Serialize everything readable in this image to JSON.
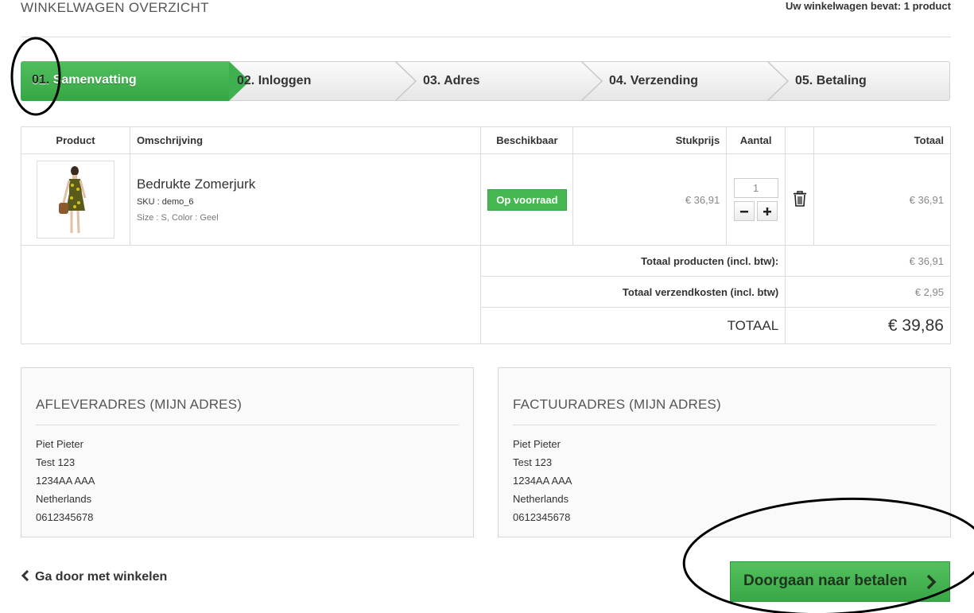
{
  "header": {
    "title": "WINKELWAGEN OVERZICHT",
    "cart_summary": "Uw winkelwagen bevat: 1 product"
  },
  "steps": [
    {
      "num": "01.",
      "label": " Samenvatting",
      "active": true
    },
    {
      "num": "02.",
      "label": " Inloggen",
      "active": false
    },
    {
      "num": "03.",
      "label": " Adres",
      "active": false
    },
    {
      "num": "04.",
      "label": " Verzending",
      "active": false
    },
    {
      "num": "05.",
      "label": " Betaling",
      "active": false
    }
  ],
  "cart_table": {
    "columns": [
      "Product",
      "Omschrijving",
      "Beschikbaar",
      "Stukprijs",
      "Aantal",
      "",
      "Totaal"
    ],
    "items": [
      {
        "name": "Bedrukte Zomerjurk",
        "sku": "SKU : demo_6",
        "attributes": "Size : S, Color : Geel",
        "availability": "Op voorraad",
        "unit_price": "€ 36,91",
        "quantity": "1",
        "total": "€ 36,91"
      }
    ],
    "summary": {
      "products_label": "Totaal producten (incl. btw):",
      "products_value": "€ 36,91",
      "shipping_label": "Totaal verzendkosten (incl. btw)",
      "shipping_value": "€ 2,95",
      "total_label": "TOTAAL",
      "total_value": "€ 39,86"
    }
  },
  "delivery_address": {
    "title": "AFLEVERADRES (MIJN ADRES)",
    "lines": [
      "Piet Pieter",
      "Test 123",
      "1234AA AAA",
      "Netherlands",
      "0612345678"
    ]
  },
  "invoice_address": {
    "title": "FACTUURADRES (MIJN ADRES)",
    "lines": [
      "Piet Pieter",
      "Test 123",
      "1234AA AAA",
      "Netherlands",
      "0612345678"
    ]
  },
  "footer": {
    "continue_shopping": "Ga door met winkelen",
    "proceed_to_pay": "Doorgaan naar betalen"
  },
  "colors": {
    "accent_green": "#46b852",
    "annotation_ink": "#000000"
  },
  "icons": [
    "chevron-left-icon",
    "chevron-right-icon",
    "trash-icon",
    "minus-icon",
    "plus-icon"
  ]
}
